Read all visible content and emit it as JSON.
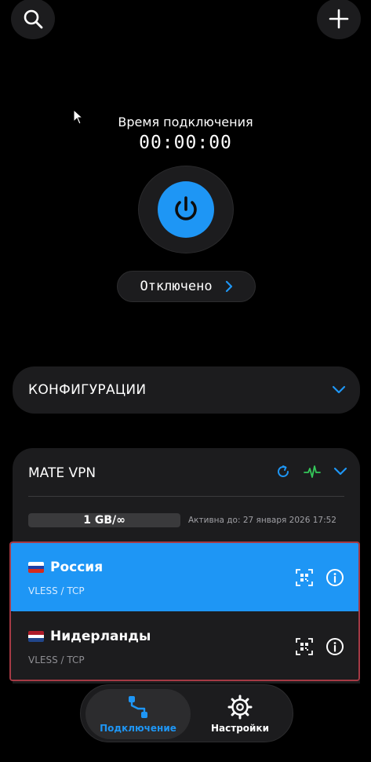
{
  "top_bar": {
    "search_icon": "search-icon",
    "add_icon": "plus-icon"
  },
  "connection": {
    "timer_label": "Время подключения",
    "timer_value": "00:00:00",
    "status_text": "Отключено"
  },
  "configs": {
    "title": "КОНФИГУРАЦИИ"
  },
  "subscription": {
    "name": "MATE VPN",
    "traffic": "1 GB/∞",
    "expiry": "Активна до: 27 января 2026 17:52"
  },
  "servers": [
    {
      "name": "Россия",
      "protocol": "VLESS / TCP",
      "flag": [
        "#ffffff",
        "#1c3fa8",
        "#d52b1e"
      ]
    },
    {
      "name": "Нидерланды",
      "protocol": "VLESS / TCP",
      "flag": [
        "#ae1c28",
        "#ffffff",
        "#21468b"
      ]
    }
  ],
  "nav": {
    "connection_label": "Подключение",
    "settings_label": "Настройки"
  },
  "colors": {
    "accent": "#1e96f5",
    "card": "#1c1c1e",
    "ping_green": "#34c759",
    "selection_border": "#a63a45"
  }
}
